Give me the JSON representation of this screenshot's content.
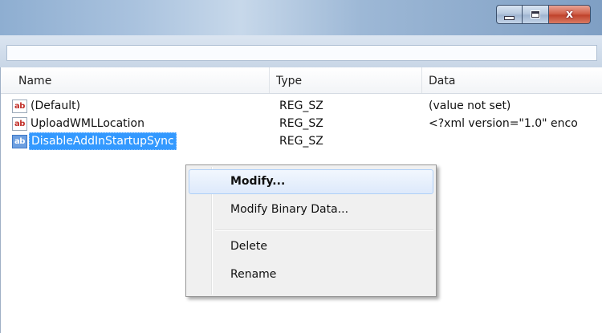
{
  "columns": {
    "name": "Name",
    "type": "Type",
    "data": "Data"
  },
  "rows": [
    {
      "icon": "ab",
      "name": "(Default)",
      "type": "REG_SZ",
      "data": "(value not set)"
    },
    {
      "icon": "ab",
      "name": "UploadWMLLocation",
      "type": "REG_SZ",
      "data": "<?xml version=\"1.0\" enco"
    },
    {
      "icon": "ab",
      "name": "DisableAddInStartupSync",
      "type": "REG_SZ",
      "data": ""
    }
  ],
  "context_menu": {
    "items": [
      "Modify...",
      "Modify Binary Data...",
      "Delete",
      "Rename"
    ]
  },
  "window_controls": {
    "close": "x"
  },
  "icons": {
    "value": "string-value-icon",
    "minimize": "minimize-icon",
    "maximize": "maximize-icon",
    "close": "close-icon"
  },
  "colors": {
    "selection": "#3399ff",
    "menu_bg": "#f0f0f0",
    "close_button": "#c0432c"
  }
}
